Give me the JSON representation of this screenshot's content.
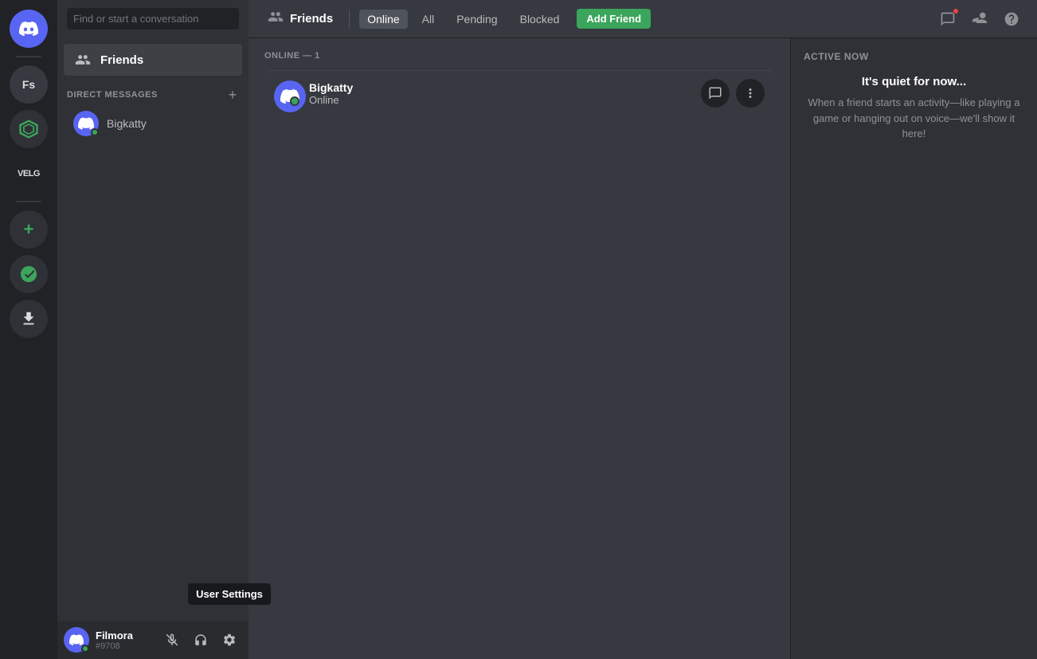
{
  "server_sidebar": {
    "items": [
      {
        "id": "discord-home",
        "label": "Discord Home",
        "icon": "discord-logo",
        "type": "home"
      },
      {
        "id": "fs",
        "label": "Fs",
        "type": "server",
        "initials": "Fs"
      },
      {
        "id": "nitro",
        "label": "Nitro",
        "type": "nitro",
        "icon": "nitro-icon"
      },
      {
        "id": "velg",
        "label": "VELG",
        "type": "server",
        "initials": "VELG"
      },
      {
        "id": "add-server",
        "label": "Add a Server",
        "type": "add",
        "icon": "+"
      },
      {
        "id": "explore",
        "label": "Explore Public Servers",
        "type": "explore"
      },
      {
        "id": "download",
        "label": "Download Apps",
        "type": "download"
      }
    ]
  },
  "dm_sidebar": {
    "search_placeholder": "Find or start a conversation",
    "friends_label": "Friends",
    "direct_messages_label": "DIRECT MESSAGES",
    "add_dm_label": "+",
    "dm_users": [
      {
        "id": "bigkatty-dm",
        "username": "Bigkatty",
        "status": "online"
      }
    ]
  },
  "user_panel": {
    "username": "Filmora",
    "discriminator": "#9708",
    "actions": [
      {
        "id": "mute",
        "icon": "🎤",
        "label": "Mute"
      },
      {
        "id": "deafen",
        "icon": "🎧",
        "label": "Deafen"
      },
      {
        "id": "settings",
        "icon": "⚙",
        "label": "User Settings"
      }
    ],
    "tooltip": "User Settings"
  },
  "top_nav": {
    "friends_label": "Friends",
    "tabs": [
      {
        "id": "online",
        "label": "Online",
        "active": true
      },
      {
        "id": "all",
        "label": "All",
        "active": false
      },
      {
        "id": "pending",
        "label": "Pending",
        "active": false
      },
      {
        "id": "blocked",
        "label": "Blocked",
        "active": false
      }
    ],
    "add_friend_label": "Add Friend",
    "icons": [
      {
        "id": "new-group-dm",
        "label": "New Group DM",
        "badge": true
      },
      {
        "id": "inbox",
        "label": "Inbox"
      },
      {
        "id": "help",
        "label": "Help"
      }
    ]
  },
  "friends_list": {
    "online_header": "ONLINE — 1",
    "friends": [
      {
        "id": "bigkatty",
        "username": "Bigkatty",
        "status": "Online",
        "avatar_color": "#5865f2"
      }
    ]
  },
  "active_now": {
    "title": "ACTIVE NOW",
    "quiet_title": "It's quiet for now...",
    "quiet_desc": "When a friend starts an activity—like playing a game or hanging out on voice—we'll show it here!"
  }
}
